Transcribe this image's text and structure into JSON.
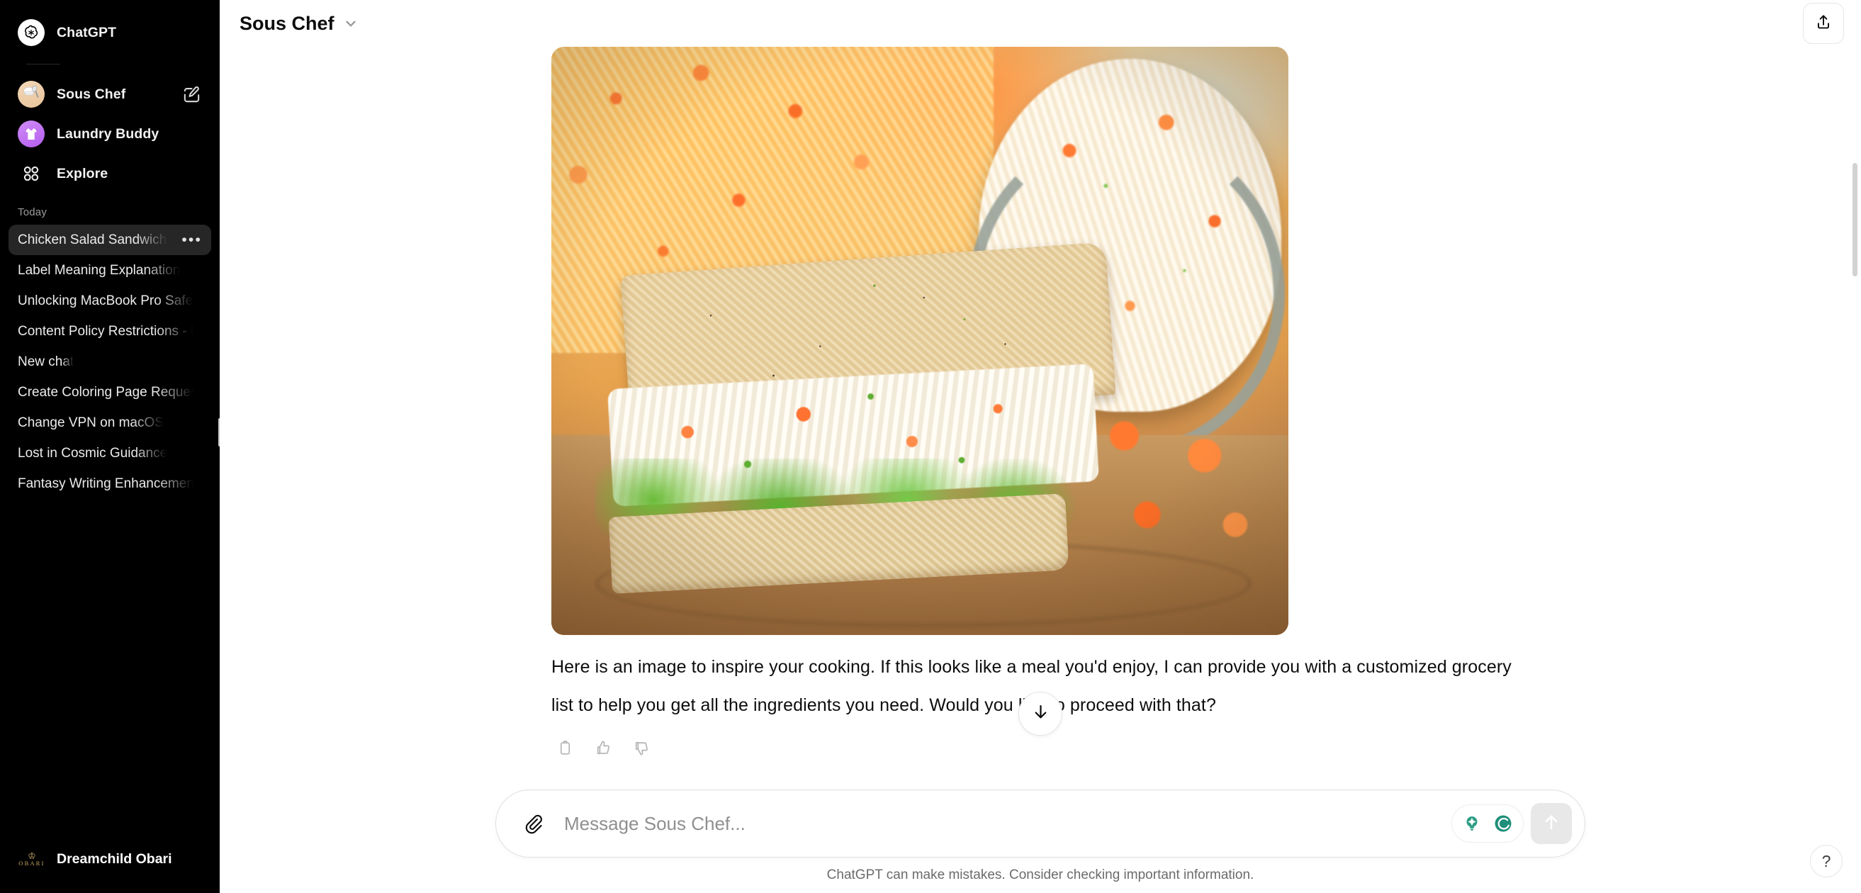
{
  "sidebar": {
    "brand": {
      "label": "ChatGPT",
      "icon": "openai-logo-icon"
    },
    "gpts": [
      {
        "label": "Sous Chef",
        "icon": "chef-avatar-icon",
        "has_edit": true,
        "edit_icon": "new-chat-edit-icon"
      },
      {
        "label": "Laundry Buddy",
        "icon": "laundry-avatar-icon",
        "has_edit": false
      }
    ],
    "explore": {
      "label": "Explore",
      "icon": "explore-grid-icon"
    },
    "section_label": "Today",
    "chats": [
      {
        "title": "Chicken Salad Sandwich & Ca",
        "active": true,
        "menu_icon": "ellipsis-icon"
      },
      {
        "title": "Label Meaning Explanation",
        "active": false
      },
      {
        "title": "Unlocking MacBook Pro Safely",
        "active": false
      },
      {
        "title": "Content Policy Restrictions - Unab",
        "active": false
      },
      {
        "title": "New chat",
        "active": false
      },
      {
        "title": "Create Coloring Page Request",
        "active": false
      },
      {
        "title": "Change VPN on macOS",
        "active": false
      },
      {
        "title": "Lost in Cosmic Guidance",
        "active": false
      },
      {
        "title": "Fantasy Writing Enhancement",
        "active": false
      }
    ],
    "user": {
      "name": "Dreamchild Obari",
      "logo_crown": "♔",
      "logo_text": "OBARI"
    }
  },
  "topbar": {
    "model_name": "Sous Chef",
    "chevron_icon": "chevron-down-icon",
    "share_icon": "share-upload-icon"
  },
  "ghost_message_header": {
    "name": "Sous Chef",
    "avatar_icon": "chef-avatar-icon"
  },
  "message": {
    "image_alt": "chicken-salad-sandwich-with-rice-photo",
    "body": "Here is an image to inspire your cooking. If this looks like a meal you'd enjoy, I can provide you with a customized grocery list to help you get all the ingredients you need. Would you like to proceed with that?",
    "actions": [
      {
        "name": "copy-icon",
        "label": "Copy"
      },
      {
        "name": "thumbs-up-icon",
        "label": "Good response"
      },
      {
        "name": "thumbs-down-icon",
        "label": "Bad response"
      }
    ]
  },
  "scroll_to_bottom": {
    "icon": "arrow-down-icon"
  },
  "composer": {
    "attach_icon": "paperclip-icon",
    "placeholder": "Message Sous Chef...",
    "value": "",
    "extension_icons": [
      {
        "name": "grammarly-bulb-icon",
        "color": "#2e9e86"
      },
      {
        "name": "grammarly-circle-icon",
        "color": "#1e8f7a"
      }
    ],
    "send_icon": "send-arrow-up-icon"
  },
  "footer": {
    "disclaimer": "ChatGPT can make mistakes. Consider checking important information."
  },
  "help": {
    "label": "?",
    "icon": "help-question-icon"
  },
  "colors": {
    "sidebar_bg": "#000000",
    "main_bg": "#ffffff",
    "active_chat_bg": "#262626",
    "text_primary": "#0d0d0d",
    "text_muted": "#6b6b6b",
    "accent_green": "#2e9e86",
    "laundry_purple": "#b45df0"
  }
}
